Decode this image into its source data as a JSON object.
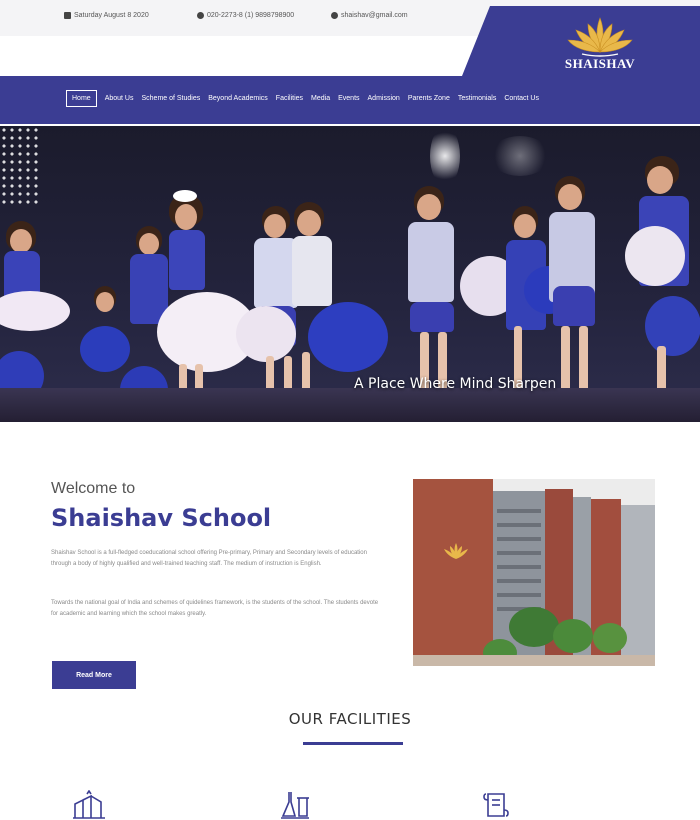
{
  "topbar": {
    "date": "Saturday August 8 2020",
    "phone": "020-2273-8 (1) 9898798900",
    "email": "shaishav@gmail.com"
  },
  "brand": {
    "name": "SHAISHAV",
    "primary_color": "#3b3d93"
  },
  "nav": {
    "items": [
      {
        "label": "Home",
        "active": true
      },
      {
        "label": "About Us"
      },
      {
        "label": "Scheme of Studies"
      },
      {
        "label": "Beyond Academics"
      },
      {
        "label": "Facilities"
      },
      {
        "label": "Media"
      },
      {
        "label": "Events"
      },
      {
        "label": "Admission"
      },
      {
        "label": "Parents Zone"
      },
      {
        "label": "Testimonials"
      },
      {
        "label": "Contact Us"
      }
    ]
  },
  "hero": {
    "caption": "A Place Where Mind Sharpen"
  },
  "welcome": {
    "pre_title": "Welcome to",
    "title": "Shaishav School",
    "paragraph1": "Shaishav School is a full-fledged coeducational school offering Pre-primary, Primary and Secondary levels of education through a body of highly qualified and well-trained teaching staff. The medium of instruction is English.",
    "paragraph2": "Towards the national goal of India and schemes of quidelines framework, is the students of the school. The students devote for academic and learning which the school makes greatly.",
    "read_more": "Read More"
  },
  "facilities": {
    "title": "OUR FACILITIES",
    "icons": [
      "library-icon",
      "science-lab-icon",
      "scroll-icon"
    ]
  }
}
